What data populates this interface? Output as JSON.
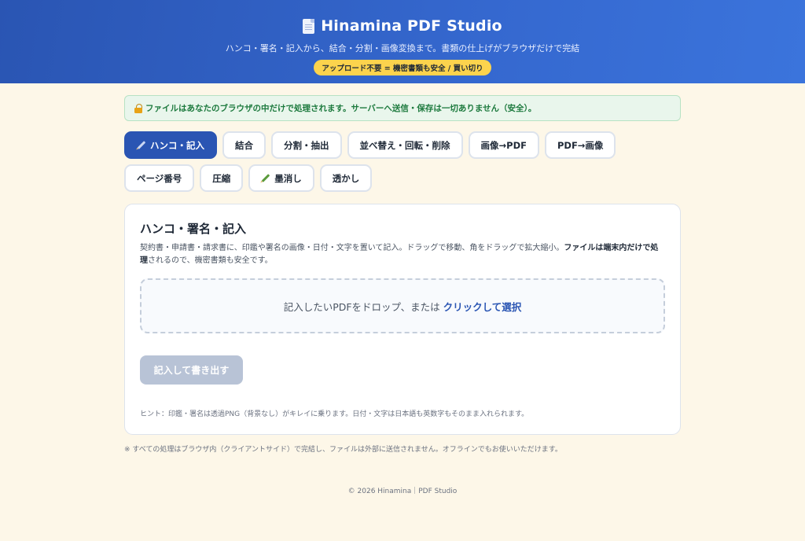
{
  "header": {
    "title": "Hinamina PDF Studio",
    "subtitle": "ハンコ・署名・記入から、結合・分割・画像変換まで。書類の仕上げがブラウザだけで完結",
    "tagline": "アップロード不要 = 機密書類も安全 / 買い切り",
    "icon": "document-icon"
  },
  "notice": {
    "icon": "lock-icon",
    "text": "ファイルはあなたのブラウザの中だけで処理されます。サーバーへ送信・保存は一切ありません（安全）。"
  },
  "tabs": [
    {
      "label": "ハンコ・記入",
      "icon": "pen-icon",
      "active": true
    },
    {
      "label": "結合"
    },
    {
      "label": "分割・抽出"
    },
    {
      "label": "並べ替え・回転・削除"
    },
    {
      "label": "画像→PDF"
    },
    {
      "label": "PDF→画像"
    },
    {
      "label": "ページ番号"
    },
    {
      "label": "圧縮"
    },
    {
      "label": "墨消し",
      "icon": "marker-icon"
    },
    {
      "label": "透かし"
    }
  ],
  "panel": {
    "title": "ハンコ・署名・記入",
    "desc_plain_1": "契約書・申請書・請求書に、印鑑や署名の画像・日付・文字を置いて記入。ドラッグで移動、角をドラッグで拡大縮小。",
    "desc_bold": "ファイルは端末内だけで処理",
    "desc_plain_2": "されるので、機密書類も安全です。",
    "dropzone_text": "記入したいPDFをドロップ、または",
    "dropzone_link": "クリックして選択",
    "export_label": "記入して書き出す",
    "hint": "ヒント：印鑑・署名は透過PNG（背景なし）がキレイに乗ります。日付・文字は日本語も英数字もそのまま入れられます。"
  },
  "footnote": "※ すべての処理はブラウザ内（クライアントサイド）で完結し、ファイルは外部に送信されません。オフラインでもお使いいただけます。",
  "copyright": "© 2026 Hinamina｜PDF Studio",
  "colors": {
    "primary": "#2a55b3",
    "background": "#fdf7e8",
    "notice_bg": "#e9f6ec",
    "notice_text": "#1d7a3e",
    "tagline_bg": "#fcd34d",
    "disabled_button": "#b8c3d6"
  }
}
